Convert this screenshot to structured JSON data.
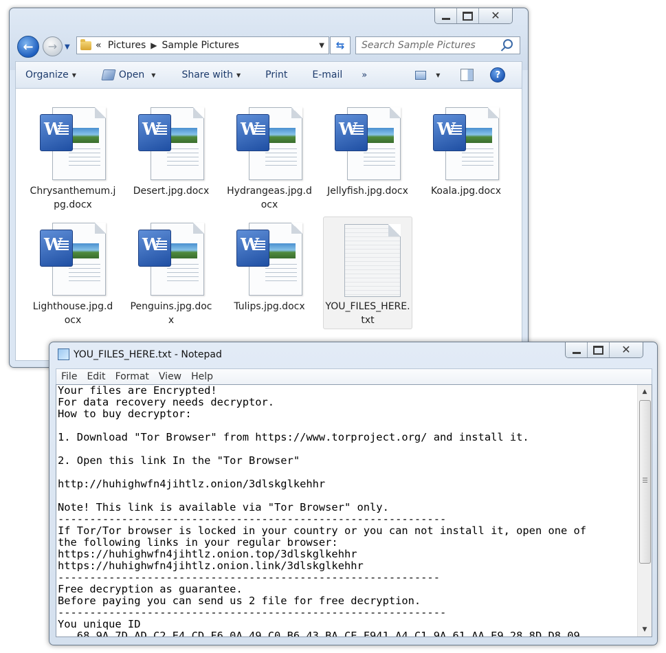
{
  "explorer": {
    "breadcrumb": {
      "overflow": "«",
      "parts": [
        "Pictures",
        "Sample Pictures"
      ],
      "separator": "▶"
    },
    "search_placeholder": "Search Sample Pictures",
    "toolbar": {
      "organize": "Organize",
      "open": "Open",
      "share_with": "Share with",
      "print": "Print",
      "email": "E-mail",
      "more": "»"
    },
    "files": [
      {
        "name": "Chrysanthemum.j\npg.docx",
        "type": "docx"
      },
      {
        "name": "Desert.jpg.docx",
        "type": "docx"
      },
      {
        "name": "Hydrangeas.jpg.d\nocx",
        "type": "docx"
      },
      {
        "name": "Jellyfish.jpg.docx",
        "type": "docx"
      },
      {
        "name": "Koala.jpg.docx",
        "type": "docx"
      },
      {
        "name": "Lighthouse.jpg.d\nocx",
        "type": "docx"
      },
      {
        "name": "Penguins.jpg.doc\nx",
        "type": "docx"
      },
      {
        "name": "Tulips.jpg.docx",
        "type": "docx"
      },
      {
        "name": "YOU_FILES_HERE.\ntxt",
        "type": "txt"
      }
    ],
    "word_badge_letter": "W"
  },
  "notepad": {
    "title": "YOU_FILES_HERE.txt - Notepad",
    "menu": [
      "File",
      "Edit",
      "Format",
      "View",
      "Help"
    ],
    "content": "Your files are Encrypted!\nFor data recovery needs decryptor.\nHow to buy decryptor:\n\n1. Download \"Tor Browser\" from https://www.torproject.org/ and install it.\n\n2. Open this link In the \"Tor Browser\"\n\nhttp://huhighwfn4jihtlz.onion/3dlskglkehhr\n\nNote! This link is available via \"Tor Browser\" only.\n-------------------------------------------------------------\nIf Tor/Tor browser is locked in your country or you can not install it, open one of\nthe following links in your regular browser:\nhttps://huhighwfn4jihtlz.onion.top/3dlskglkehhr\nhttps://huhighwfn4jihtlz.onion.link/3dlskglkehhr\n------------------------------------------------------------\nFree decryption as guarantee.\nBefore paying you can send us 2 file for free decryption.\n-------------------------------------------------------------\nYou unique ID\n   68 9A 7D AD C2 E4 CD F6 0A 49 C0 B6 43 BA CE F941 A4 C1 9A 61 AA E9 28 8D D8 09"
  }
}
